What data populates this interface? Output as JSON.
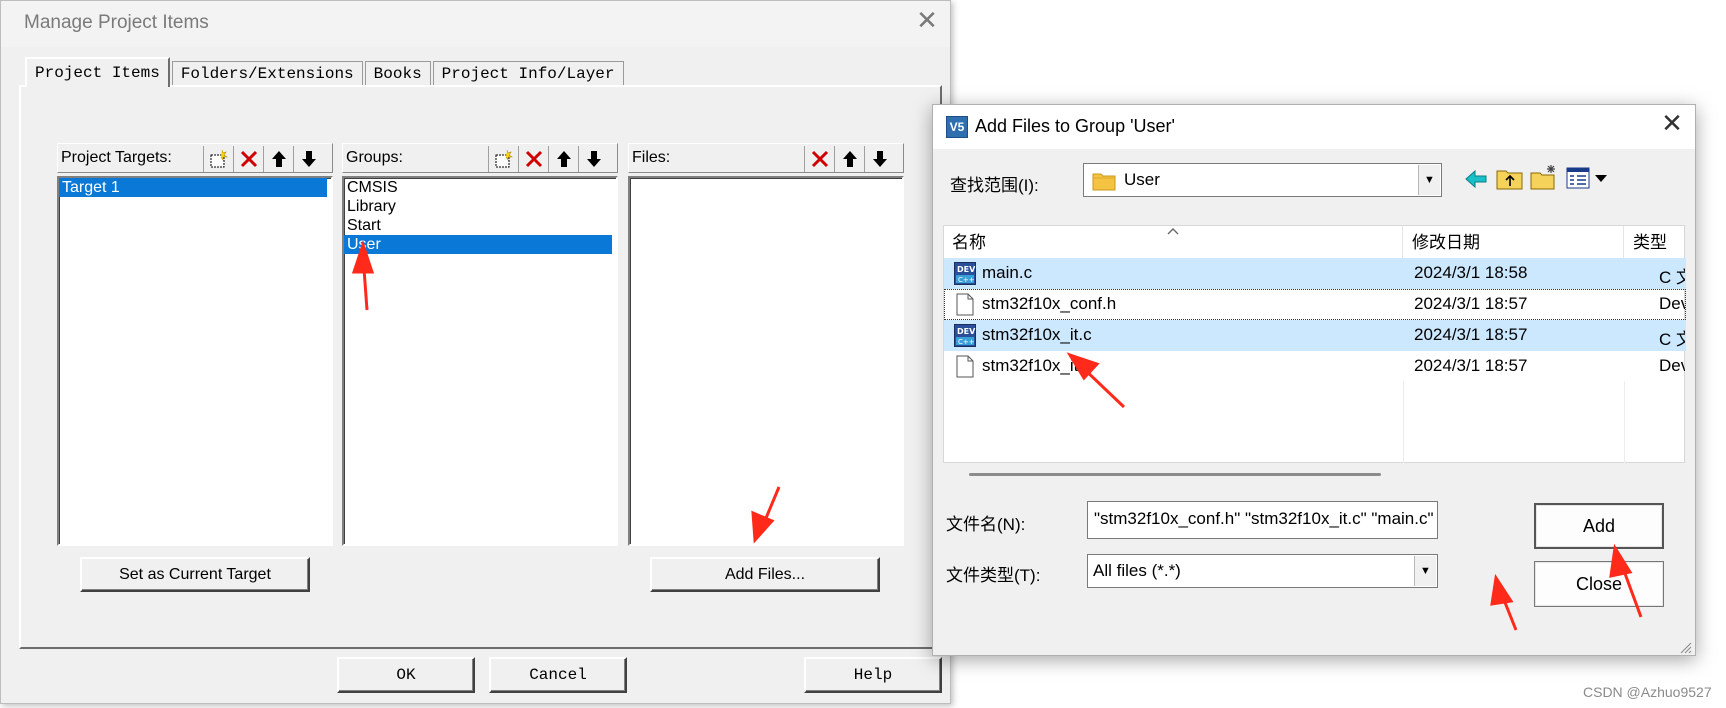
{
  "manage_dialog": {
    "title": "Manage Project Items",
    "tabs": [
      "Project Items",
      "Folders/Extensions",
      "Books",
      "Project Info/Layer"
    ],
    "targets": {
      "header": "Project Targets:",
      "items": [
        "Target 1"
      ]
    },
    "groups": {
      "header": "Groups:",
      "items": [
        "CMSIS",
        "Library",
        "Start",
        "User"
      ]
    },
    "files": {
      "header": "Files:",
      "items": []
    },
    "set_target_button": "Set as Current Target",
    "add_files_button": "Add Files...",
    "ok_button": "OK",
    "cancel_button": "Cancel",
    "help_button": "Help"
  },
  "add_files_dialog": {
    "title": "Add Files to Group 'User'",
    "look_in_label": "查找范围(I):",
    "look_in_value": "User",
    "columns": {
      "name": "名称",
      "date": "修改日期",
      "type": "类型"
    },
    "files": [
      {
        "name": "main.c",
        "date": "2024/3/1 18:58",
        "type": "C 文件",
        "icon": "c-source-file-icon",
        "selected": true
      },
      {
        "name": "stm32f10x_conf.h",
        "date": "2024/3/1 18:57",
        "type": "Dev",
        "icon": "header-file-icon",
        "selected": false,
        "focused": true
      },
      {
        "name": "stm32f10x_it.c",
        "date": "2024/3/1 18:57",
        "type": "C 文件",
        "icon": "c-source-file-icon",
        "selected": true
      },
      {
        "name": "stm32f10x_it.h",
        "date": "2024/3/1 18:57",
        "type": "Dev",
        "icon": "header-file-icon",
        "selected": false
      }
    ],
    "filename_label": "文件名(N):",
    "filename_value": "\"stm32f10x_conf.h\" \"stm32f10x_it.c\" \"main.c\"",
    "filetype_label": "文件类型(T):",
    "filetype_value": "All files (*.*)",
    "add_button": "Add",
    "close_button": "Close"
  },
  "watermark": "CSDN @Azhuo9527",
  "colors": {
    "selection": "#0a78d7",
    "list_selection": "#cce8ff",
    "annotation": "#ff2a1a"
  }
}
